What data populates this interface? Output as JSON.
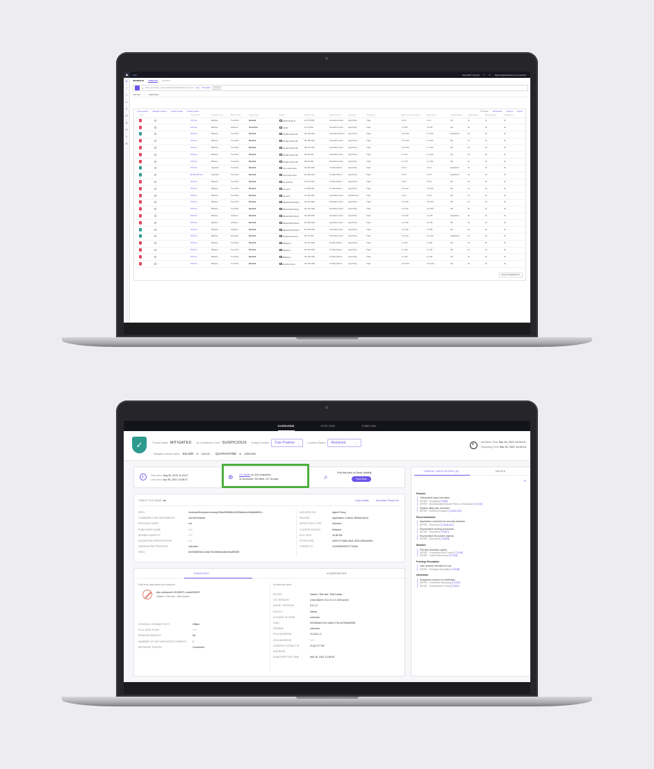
{
  "screen1": {
    "breadcrumb": "Sites",
    "account_menu": [
      "Sing ANNY Account",
      "?",
      "↻",
      "dgarimax@sentinelone.com (Admin)"
    ],
    "sidebar_icons": [
      "sentinel-logo-icon",
      "dashboard-icon",
      "search-icon",
      "incidents-icon",
      "activity-icon",
      "threats-icon",
      "network-icon",
      "apps-icon",
      "users-icon",
      "settings-icon"
    ],
    "tabs": [
      "INCIDENTS",
      "THREATS",
      "ALERTS"
    ],
    "search": {
      "placeholder": "Filter your entries, saved, attacker/endpoint/hash, threat info",
      "links": [
        "Copy",
        "Show/Hide",
        "Create"
      ]
    },
    "filter": {
      "time_label": "Last Year",
      "select_label": "Select filters..."
    },
    "toolbar": {
      "actions": [
        "Threat Actions",
        "Mitigation Actions",
        "Analyst Verdict",
        "Incident Status"
      ],
      "right": [
        "47 Threats",
        "100 Results",
        "Columns",
        "Export"
      ]
    },
    "columns": [
      "Status",
      "Threat Details",
      "Confidence Level",
      "Analyst Verdict",
      "Incident Status",
      "Endpoint",
      "Reported Time",
      "Reporting Source",
      "Initiated By",
      "Classification",
      "Agent Version on Detection",
      "Agent Version",
      "Completed Actions",
      "Pending Actions",
      "Reboot Required",
      "Failed Actions"
    ],
    "rows": [
      {
        "status": "red",
        "threat": "TEST.exe",
        "conf": "Malicious",
        "verdict": "True Positi...",
        "inc": "Resolved",
        "endpoint": "DESKTOP-B1-C3",
        "time": "Apr 27th 2021",
        "source": "SentinelOne Cloud",
        "by": "Agent Policy",
        "cls": "Trojan",
        "ver": "4.6.14",
        "ver2": "4.6.14",
        "done": "N/A",
        "pend": "No",
        "reb": "No",
        "fail": "No"
      },
      {
        "status": "red",
        "threat": "TEST.exe",
        "conf": "Malicious",
        "verdict": "Undefined",
        "inc": "Unresolved",
        "endpoint": "QTEST",
        "time": "Apr 1st 2021",
        "source": "SentinelOne Cloud",
        "by": "Agent Policy",
        "cls": "Trojan",
        "ver": "4.3.2.86",
        "ver2": "4.3.2.86",
        "done": "N/A",
        "pend": "No",
        "reb": "No",
        "fail": "No"
      },
      {
        "status": "green",
        "threat": "TEST.exe",
        "conf": "Malicious",
        "verdict": "True Positi...",
        "inc": "Resolved",
        "endpoint": "SCHED-CLIENT-006",
        "time": "Mar 19th 2021",
        "source": "SentinelOne Static AI",
        "by": "Agent Policy",
        "cls": "Trojan",
        "ver": "4.6.11.191",
        "ver2": "4.7.2.201",
        "done": "Quarantined",
        "pend": "No",
        "reb": "No",
        "fail": "No"
      },
      {
        "status": "red",
        "threat": "TEST.exe",
        "conf": "Malicious",
        "verdict": "True Positi...",
        "inc": "Resolved",
        "endpoint": "SCHED-CLIENT-008",
        "time": "Mar 18th 2021",
        "source": "SentinelOne Cloud",
        "by": "Agent Policy",
        "cls": "Trojan",
        "ver": "4.6.11.191",
        "ver2": "4.7.2.201",
        "done": "N/A",
        "pend": "No",
        "reb": "No",
        "fail": "No"
      },
      {
        "status": "red",
        "threat": "TEST.exe",
        "conf": "Malicious",
        "verdict": "True Positi...",
        "inc": "Resolved",
        "endpoint": "SCHED-CLIENT-008",
        "time": "Mar 17th 2021",
        "source": "SentinelOne Cloud",
        "by": "Agent Policy",
        "cls": "Trojan",
        "ver": "4.6.11.191",
        "ver2": "4.7.2.201",
        "done": "N/A",
        "pend": "No",
        "reb": "No",
        "fail": "No"
      },
      {
        "status": "red",
        "threat": "TEST.exe",
        "conf": "Malicious",
        "verdict": "True Positi...",
        "inc": "Resolved",
        "endpoint": "SCHED-CLIENT-008",
        "time": "Mar 8th 2021",
        "source": "SentinelOne Cloud",
        "by": "Agent Policy",
        "cls": "Trojan",
        "ver": "4.7.2.20",
        "ver2": "4.7.2.201",
        "done": "N/A",
        "pend": "No",
        "reb": "No",
        "fail": "No"
      },
      {
        "status": "red",
        "threat": "TEST.exe",
        "conf": "Malicious",
        "verdict": "True Positi...",
        "inc": "Resolved",
        "endpoint": "SCHED-CLIENT-008",
        "time": "Mar 8th 2021",
        "source": "SentinelOne Cloud",
        "by": "Agent Policy",
        "cls": "Trojan",
        "ver": "4.7.1.25",
        "ver2": "4.7.2.201",
        "done": "N/A",
        "pend": "No",
        "reb": "No",
        "fail": "No"
      },
      {
        "status": "green",
        "threat": "TEST.exe",
        "conf": "Suspicious",
        "verdict": "True Positi...",
        "inc": "Resolved",
        "endpoint": "cyber-range-master",
        "time": "Feb 26th 2021",
        "source": "On-Write Static AI",
        "by": "Agent Policy",
        "cls": "Trojan",
        "ver": "4.5.2.2",
        "ver2": "4.5.2.2",
        "done": "Quarantined",
        "pend": "No",
        "reb": "No",
        "fail": "No"
      },
      {
        "status": "green",
        "threat": "EICAR TEST.exe",
        "conf": "Suspicious",
        "verdict": "True Positi...",
        "inc": "Resolved",
        "endpoint": "cyber-range-master",
        "time": "Feb 26th 2021",
        "source": "On-Write Static AI",
        "by": "Agent Policy",
        "cls": "Trojan",
        "ver": "4.5.2.2",
        "ver2": "4.5.2.2",
        "done": "Quarantined",
        "pend": "No",
        "reb": "No",
        "fail": "No"
      },
      {
        "status": "red",
        "threat": "TEST.exe",
        "conf": "Malicious",
        "verdict": "True Positi...",
        "inc": "Resolved",
        "endpoint": "Test-github01",
        "time": "Jan 27th 2021",
        "source": "On-Write Static AI",
        "by": "Agent Policy",
        "cls": "Trojan",
        "ver": "4.5.2.2",
        "ver2": "4.5.2.2",
        "done": "N/A",
        "pend": "No",
        "reb": "No",
        "fail": "No"
      },
      {
        "status": "red",
        "threat": "TEST.exe",
        "conf": "Malicious",
        "verdict": "True Positi...",
        "inc": "Resolved",
        "endpoint": "test-win10",
        "time": "Jan 25th 2021",
        "source": "On-Write Static AI",
        "by": "Agent Policy",
        "cls": "Trojan",
        "ver": "4.2.2.104",
        "ver2": "4.2.4.104",
        "done": "N/A",
        "pend": "No",
        "reb": "No",
        "fail": "No"
      },
      {
        "status": "red",
        "threat": "TEST.exe",
        "conf": "Malicious",
        "verdict": "True Positi...",
        "inc": "Resolved",
        "endpoint": "test-win10",
        "time": "Jan 19th 2021",
        "source": "SentinelOne Cloud",
        "by": "Full Disk Scan",
        "cls": "Trojan",
        "ver": "4.2.4.1",
        "ver2": "4.6.4.9",
        "done": "N/A",
        "pend": "No",
        "reb": "No",
        "fail": "No"
      },
      {
        "status": "red",
        "threat": "TEST.exe",
        "conf": "Malicious",
        "verdict": "True Positi...",
        "inc": "Resolved",
        "endpoint": "MiDhat-MACOS-BedS...",
        "time": "Dec 31st 2020",
        "source": "SentinelOne Cloud",
        "by": "Agent Policy",
        "cls": "Trojan",
        "ver": "4.4.2.149",
        "ver2": "4.6.4.149",
        "done": "N/A",
        "pend": "No",
        "reb": "No",
        "fail": "No"
      },
      {
        "status": "red",
        "threat": "TEST.exe",
        "conf": "Malicious",
        "verdict": "True Positi...",
        "inc": "Resolved",
        "endpoint": "MiDhat-MACOS-BedS...",
        "time": "Dec 31st 2020",
        "source": "SentinelOne Cloud",
        "by": "Agent Policy",
        "cls": "Trojan",
        "ver": "4.4.2.149",
        "ver2": "4.6.4.149",
        "done": "N/A",
        "pend": "No",
        "reb": "No",
        "fail": "No"
      },
      {
        "status": "red",
        "threat": "TEST.exe",
        "conf": "Malicious",
        "verdict": "Undefined",
        "inc": "Resolved",
        "endpoint": "MiDhat-MACOS-BedS...",
        "time": "Dec 28th 2020",
        "source": "SentinelOne Cloud",
        "by": "Agent Policy",
        "cls": "Trojan",
        "ver": "4.4.2.149",
        "ver2": "4.2.2.86",
        "done": "Quarantined",
        "pend": "No",
        "reb": "No",
        "fail": "No"
      },
      {
        "status": "red",
        "threat": "TEST.exe",
        "conf": "Malicious",
        "verdict": "Undefined",
        "inc": "Resolved",
        "endpoint": "MiDhat-MACOS-BedS...",
        "time": "Dec 28th 2020",
        "source": "SentinelOne Cloud",
        "by": "Agent Policy",
        "cls": "Trojan",
        "ver": "4.4.2.149",
        "ver2": "4.2.2.86",
        "done": "N/A",
        "pend": "No",
        "reb": "No",
        "fail": "No"
      },
      {
        "status": "green",
        "threat": "TEST.exe",
        "conf": "Malicious",
        "verdict": "Undefined",
        "inc": "Resolved",
        "endpoint": "MiDhat-MACOS-BedS...",
        "time": "Dec 28th 2020",
        "source": "SentinelOne Cloud",
        "by": "Agent Policy",
        "cls": "Trojan",
        "ver": "4.4.2.149",
        "ver2": "4.2.2.86",
        "done": "N/A",
        "pend": "No",
        "reb": "No",
        "fail": "No"
      },
      {
        "status": "green",
        "threat": "TEST.exe",
        "conf": "Malicious",
        "verdict": "Suspicious",
        "inc": "Resolved",
        "endpoint": "NeoMatrix-Win10-Ho...",
        "time": "Dec 1st 2020",
        "source": "SentinelOne Cloud",
        "by": "Agent Policy",
        "cls": "Trojan",
        "ver": "4.4.2.143",
        "ver2": "4.4.2.143",
        "done": "Quarantined",
        "pend": "No",
        "reb": "No",
        "fail": "No"
      },
      {
        "status": "red",
        "threat": "TEST.exe",
        "conf": "Malicious",
        "verdict": "True Positi...",
        "inc": "Resolved",
        "endpoint": "PMEDrudo...",
        "time": "Nov 24th 2020",
        "source": "On-Write Static AI",
        "by": "Agent Policy",
        "cls": "Trojan",
        "ver": "4.1.4.82",
        "ver2": "4.1.4.82",
        "done": "N/A",
        "pend": "No",
        "reb": "No",
        "fail": "No"
      },
      {
        "status": "red",
        "threat": "TEST.exe",
        "conf": "Malicious",
        "verdict": "True Positi...",
        "inc": "Resolved",
        "endpoint": "PMEDrudo...",
        "time": "Nov 24th 2020",
        "source": "On-Write Static AI",
        "by": "Agent Policy",
        "cls": "Trojan",
        "ver": "4.1.4.82",
        "ver2": "4.1.4.82",
        "done": "N/A",
        "pend": "No",
        "reb": "No",
        "fail": "No"
      },
      {
        "status": "red",
        "threat": "TEST.exe",
        "conf": "Malicious",
        "verdict": "True Positi...",
        "inc": "Resolved",
        "endpoint": "PMEDrudo...",
        "time": "Nov 24th 2020",
        "source": "On-Write Static AI",
        "by": "Agent Policy",
        "cls": "Trojan",
        "ver": "4.1.4.82",
        "ver2": "4.1.4.82",
        "done": "N/A",
        "pend": "No",
        "reb": "No",
        "fail": "No"
      },
      {
        "status": "red",
        "threat": "TEST.exe",
        "conf": "Malicious",
        "verdict": "True Positi...",
        "inc": "Resolved",
        "endpoint": "Dan-Win10-Simu...",
        "time": "Nov 20th 2020",
        "source": "On-Write Static AI",
        "by": "Agent Policy",
        "cls": "Trojan",
        "ver": "4.6.12.191",
        "ver2": "4.6.12.191",
        "done": "N/A",
        "pend": "No",
        "reb": "No",
        "fail": "No"
      }
    ],
    "tooltip": "Apurva's MacBook Pro"
  },
  "screen2": {
    "nav": [
      "OVERVIEW",
      "EXPLORE",
      "TIMELINE"
    ],
    "header": {
      "shield_icon": "shield-check-icon",
      "threat_status_label": "Threat Status",
      "threat_status": "MITIGATED",
      "ai_conf_label": "AI Confidence Level",
      "ai_conf": "SUSPICIOUS",
      "verdict_label": "Analyst Verdict",
      "verdict": "True Positive",
      "incident_label": "Incident Status",
      "incident": "Resolved",
      "mitigation_label": "Mitigation Actions taken",
      "killed": "KILLED",
      "killed_count": "112/112",
      "quarantine": "QUARANTINE",
      "quarantine_count": "1356/1390",
      "identified_label": "Identified Time",
      "identified": "Mar 26, 2021 13:16:13",
      "reporting_label": "Reporting Time",
      "reporting": "Mar 26, 2021 13:16:13"
    },
    "info": {
      "first_seen_label": "First seen",
      "first_seen": "Aug 28, 2019 11:16:27",
      "last_seen_label": "Last seen",
      "last_seen": "Apr 06, 2021 14:36:07",
      "times": "721 times",
      "on": "on",
      "endpoints": "424 endpoints",
      "groups": "11 Accounts / 54 Sites / 67 Groups",
      "dv_text": "Find this hash on Deep Visibility",
      "hunt_btn": "Hunt Now"
    },
    "file": {
      "name_label": "THREAT FILE NAME",
      "name": "cat",
      "copy_link": "Copy Details",
      "download_link": "Download Threat File",
      "left": [
        {
          "k": "PATH",
          "v": "/host/var/lib/docker/overlay2/9fed3908f6b2c15f0dfdd4c2bd8d665511..."
        },
        {
          "k": "COMMAND LINE ARGUMENTS",
          "v": "cat /etc/shadow"
        },
        {
          "k": "PROCESS USER",
          "v": "n/a"
        },
        {
          "k": "PUBLISHER NAME",
          "v": "N/A"
        },
        {
          "k": "SIGNER IDENTITY",
          "v": "N/A"
        },
        {
          "k": "SIGNATURE VERIFICATION",
          "v": "N/A"
        },
        {
          "k": "ORIGINATING PROCESS",
          "v": "unknown"
        },
        {
          "k": "SHA1",
          "v": "f4e2b58ef3e1c2dab7d14f5dcfa1d6dc9ad55339"
        }
      ],
      "right": [
        {
          "k": "INITIATED BY",
          "v": "Agent Policy"
        },
        {
          "k": "ENGINE",
          "v": "Application Control, Behavioral AI"
        },
        {
          "k": "DETECTION TYPE",
          "v": "Dynamic"
        },
        {
          "k": "CLASSIFICATION",
          "v": "Malware"
        },
        {
          "k": "FILE SIZE",
          "v": "34.85 KB"
        },
        {
          "k": "STORYLINE",
          "v": "a2f37e7f-fa8e-b6d1-4020-f2fe4eede0..."
        },
        {
          "k": "THREAT ID",
          "v": "1120300000927719184"
        }
      ]
    },
    "endpoint": {
      "tabs": [
        "ENDPOINT",
        "KUBERNETES"
      ],
      "realtime_label": "Real time data about the endpoint:",
      "detection_label": "At detection time:",
      "name": "aks-nodepool1-91265971-vmss000000",
      "site": "Hawrie / K8s site / K8s Nodes",
      "left": [
        {
          "k": "CONSOLE CONNECTIVITY",
          "v": "Offline"
        },
        {
          "k": "FULL DISK SCAN",
          "v": "N/A"
        },
        {
          "k": "PENDING REBOOT",
          "v": "No"
        },
        {
          "k": "NUMBER OF NOT MITIGATED THREATS",
          "v": "1"
        },
        {
          "k": "NETWORK STATUS",
          "v": "Connected"
        }
      ],
      "right": [
        {
          "k": "SCOPE",
          "v": "Hawrie / K8s site / K8s Nodes"
        },
        {
          "k": "OS VERSION",
          "v": "Linux Alpine v3.11 5.4.0-1040-azure"
        },
        {
          "k": "AGENT VERSION",
          "v": "5.0.1.3"
        },
        {
          "k": "POLICY",
          "v": "Detect"
        },
        {
          "k": "LOGGED IN USER",
          "v": "unknown"
        },
        {
          "k": "UUID",
          "v": "00335ea8-27ce-e48e-471b-4579d6d39fd1"
        },
        {
          "k": "DOMAIN",
          "v": "unknown"
        },
        {
          "k": "IPV4 ADDRESS",
          "v": "10.244.1.2"
        },
        {
          "k": "IPV6 ADDRESS",
          "v": "N/A"
        },
        {
          "k": "CONSOLE VISIBLE IP ADDRESS",
          "v": "20.62.177.55"
        },
        {
          "k": "SUBSCRIPTION TIME",
          "v": "Mar 26, 2021 12:48:54"
        }
      ]
    },
    "indicators": {
      "tabs": [
        "THREAT INDICATORS (8)",
        "NOTES"
      ],
      "groups": [
        {
          "cat": "Evasion",
          "items": [
            {
              "t": "Obfuscated script execution.",
              "m": [
                "MITRE : Scripting ",
                "[T1064]",
                "MITRE : Deobfuscate/Decode Files or Information ",
                "[T1140]"
              ]
            },
            {
              "t": "System utility was renamed.",
              "m": [
                "MITRE : Defense Evasion ",
                "[T1036.003]"
              ]
            }
          ]
        },
        {
          "cat": "Reconnaissance",
          "items": [
            {
              "t": "Application searched for security software.",
              "m": [
                "MITRE : Discovery ",
                "[T1518.001]"
              ]
            },
            {
              "t": "Enumerated running processes.",
              "m": [
                "MITRE : Discovery ",
                "[T1057]"
              ]
            },
            {
              "t": "Enumerated file system objects.",
              "m": [
                "MITRE : Discovery ",
                "[T1083]"
              ]
            }
          ]
        },
        {
          "cat": "Malware",
          "items": [
            {
              "t": "File was remotely copied.",
              "m": [
                "MITRE : Command And Control ",
                "[T1105]",
                "MITRE : Lateral Movement ",
                "[T1105]"
              ]
            }
          ]
        },
        {
          "cat": "Privilege Escalation",
          "items": [
            {
              "t": "User session elevated to root.",
              "m": [
                "MITRE : Privilege Escalation ",
                "[T1548]"
              ]
            }
          ]
        },
        {
          "cat": "Infostealer",
          "items": [
            {
              "t": "Suspicious access to credentials.",
              "m": [
                "MITRE : Credential Dumping ",
                "[T1003]",
                "MITRE : Credentials in Files ",
                "[T1081]"
              ]
            }
          ]
        }
      ]
    }
  }
}
